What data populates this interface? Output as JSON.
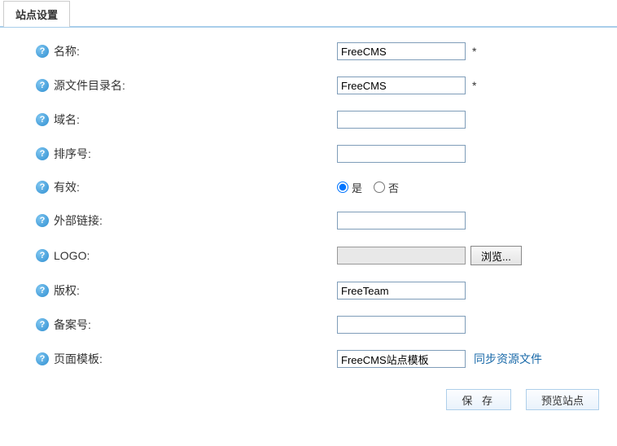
{
  "tab": {
    "label": "站点设置"
  },
  "rows": {
    "name": {
      "label": "名称:",
      "value": "FreeCMS",
      "required": "*"
    },
    "srcdir": {
      "label": "源文件目录名:",
      "value": "FreeCMS",
      "required": "*"
    },
    "domain": {
      "label": "域名:",
      "value": ""
    },
    "order": {
      "label": "排序号:",
      "value": ""
    },
    "valid": {
      "label": "有效:",
      "opt_yes": "是",
      "opt_no": "否"
    },
    "extlink": {
      "label": "外部链接:",
      "value": ""
    },
    "logo": {
      "label": "LOGO:",
      "browse": "浏览..."
    },
    "copy": {
      "label": "版权:",
      "value": "FreeTeam"
    },
    "record": {
      "label": "备案号:",
      "value": ""
    },
    "template": {
      "label": "页面模板:",
      "value": "FreeCMS站点模板",
      "sync": "同步资源文件"
    }
  },
  "buttons": {
    "save": "保 存",
    "preview": "预览站点"
  }
}
